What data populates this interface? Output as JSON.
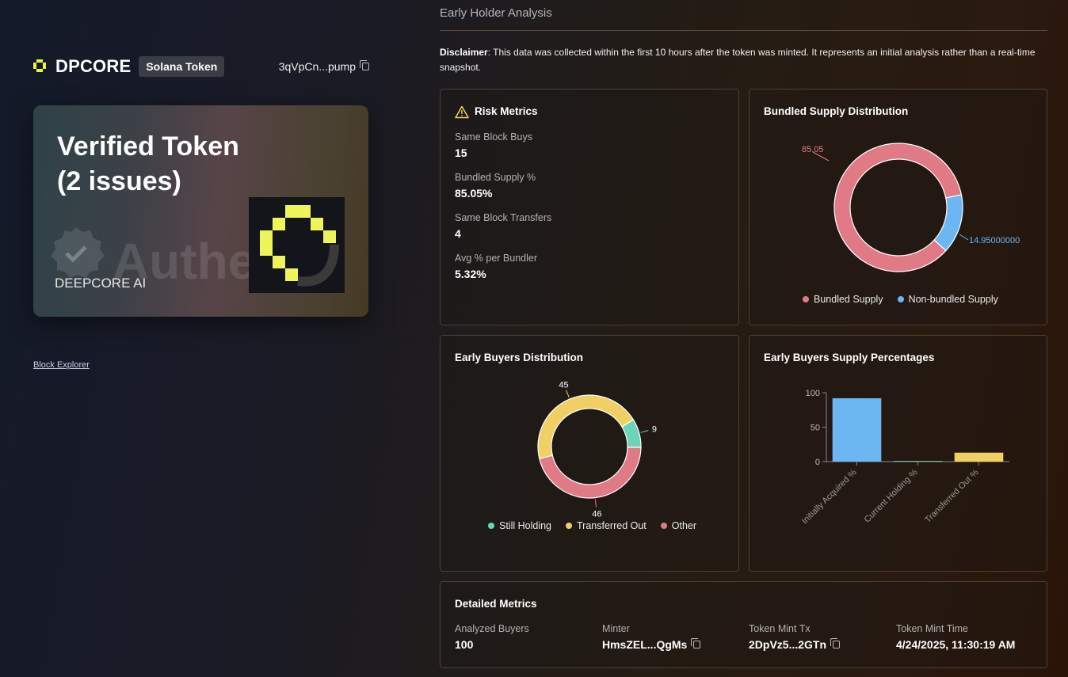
{
  "brand": {
    "name": "DPCORE",
    "chain_badge": "Solana Token",
    "address": "3qVpCn...pump"
  },
  "card": {
    "title_line1": "Verified Token",
    "title_line2": "(2 issues)",
    "brand": "DEEPCORE AI",
    "watermark": "Authentic"
  },
  "links": {
    "block_explorer": "Block Explorer"
  },
  "section": {
    "title": "Early Holder Analysis",
    "disclaimer_label": "Disclaimer",
    "disclaimer_text": ": This data was collected within the first 10 hours after the token was minted. It represents an initial analysis rather than a real-time snapshot."
  },
  "risk": {
    "title": "Risk Metrics",
    "items": [
      {
        "label": "Same Block Buys",
        "value": "15"
      },
      {
        "label": "Bundled Supply %",
        "value": "85.05%"
      },
      {
        "label": "Same Block Transfers",
        "value": "4"
      },
      {
        "label": "Avg % per Bundler",
        "value": "5.32%"
      }
    ]
  },
  "bundled": {
    "title": "Bundled Supply Distribution",
    "label_a": "85.05",
    "label_b": "14.95000000",
    "legend_a": "Bundled Supply",
    "legend_b": "Non-bundled Supply"
  },
  "buyers": {
    "title": "Early Buyers Distribution",
    "legend": [
      "Still Holding",
      "Transferred Out",
      "Other"
    ]
  },
  "supply": {
    "title": "Early Buyers Supply Percentages"
  },
  "detailed": {
    "title": "Detailed Metrics",
    "items": [
      {
        "label": "Analyzed Buyers",
        "value": "100"
      },
      {
        "label": "Minter",
        "value": "HmsZEL...QgMs"
      },
      {
        "label": "Token Mint Tx",
        "value": "2DpVz5...2GTn"
      },
      {
        "label": "Token Mint Time",
        "value": "4/24/2025, 11:30:19 AM"
      }
    ]
  },
  "colors": {
    "pink": "#e07a86",
    "blue": "#6cb6f2",
    "teal": "#6cd4b8",
    "yellow": "#f0d065",
    "brand_yellow": "#e9f53b"
  },
  "chart_data": [
    {
      "type": "pie",
      "title": "Bundled Supply Distribution",
      "categories": [
        "Bundled Supply",
        "Non-bundled Supply"
      ],
      "values": [
        85.05,
        14.95
      ],
      "legend": "bottom"
    },
    {
      "type": "pie",
      "title": "Early Buyers Distribution",
      "categories": [
        "Still Holding",
        "Transferred Out",
        "Other"
      ],
      "values": [
        9,
        45,
        46
      ],
      "legend": "bottom"
    },
    {
      "type": "bar",
      "title": "Early Buyers Supply Percentages",
      "categories": [
        "Initially Acquired %",
        "Current Holding %",
        "Transferred Out %"
      ],
      "values": [
        92,
        1,
        13
      ],
      "ylim": [
        0,
        100
      ],
      "yticks": [
        0,
        50,
        100
      ]
    }
  ]
}
